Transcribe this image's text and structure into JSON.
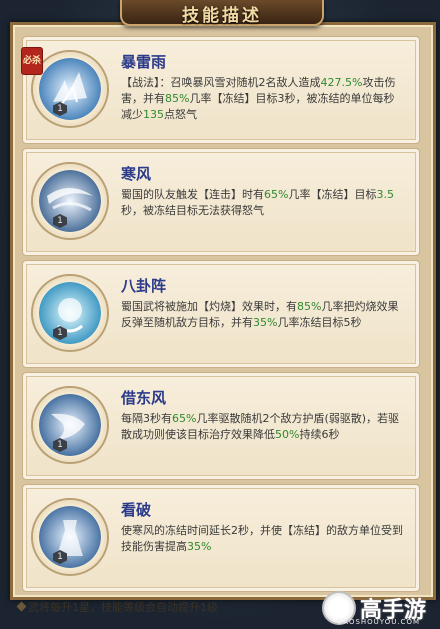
{
  "header": {
    "title": "技能描述"
  },
  "skills": [
    {
      "name": "暴雷雨",
      "badge": "必杀",
      "level": "1",
      "icon": "storm-icon",
      "desc": [
        {
          "t": "【战法】：召唤暴风雪对随机2名敌人造成"
        },
        {
          "t": "427.5%",
          "hl": true
        },
        {
          "t": "攻击伤害，并有"
        },
        {
          "t": "85%",
          "hl": true
        },
        {
          "t": "几率【冻结】目标3秒，被冻结的单位每秒减少"
        },
        {
          "t": "135",
          "hl": true
        },
        {
          "t": "点怒气"
        }
      ]
    },
    {
      "name": "寒风",
      "badge": "",
      "level": "1",
      "icon": "cold-wind-icon",
      "desc": [
        {
          "t": "蜀国的队友触发【连击】时有"
        },
        {
          "t": "65%",
          "hl": true
        },
        {
          "t": "几率【冻结】目标"
        },
        {
          "t": "3.5",
          "hl": true
        },
        {
          "t": "秒，被冻结目标无法获得怒气"
        }
      ]
    },
    {
      "name": "八卦阵",
      "badge": "",
      "level": "1",
      "icon": "bagua-icon",
      "desc": [
        {
          "t": "蜀国武将被施加【灼烧】效果时，有"
        },
        {
          "t": "85%",
          "hl": true
        },
        {
          "t": "几率把灼烧效果反弹至随机敌方目标，并有"
        },
        {
          "t": "35%",
          "hl": true
        },
        {
          "t": "几率冻结目标5秒"
        }
      ]
    },
    {
      "name": "借东风",
      "badge": "",
      "level": "1",
      "icon": "east-wind-icon",
      "desc": [
        {
          "t": "每隔3秒有"
        },
        {
          "t": "65%",
          "hl": true
        },
        {
          "t": "几率驱散随机2个敌方护盾(弱驱散)，若驱散成功则使该目标治疗效果降低"
        },
        {
          "t": "50%",
          "hl": true
        },
        {
          "t": "持续6秒"
        }
      ]
    },
    {
      "name": "看破",
      "badge": "",
      "level": "1",
      "icon": "see-through-icon",
      "desc": [
        {
          "t": "使寒风的冻结时间延长2秒，并使【冻结】的敌方单位受到技能伤害提高"
        },
        {
          "t": "35%",
          "hl": true
        }
      ]
    }
  ],
  "footer": {
    "note": "武将每升1星，技能等级会自动提升1级"
  },
  "watermark": {
    "text": "高手游",
    "url": "GAOSHOUYOU.COM",
    "icon": "gaoshouyou-logo-icon"
  },
  "colors": {
    "name": "#2b3a8a",
    "highlight": "#2f8a2f",
    "panel": "#d9c4a0"
  }
}
